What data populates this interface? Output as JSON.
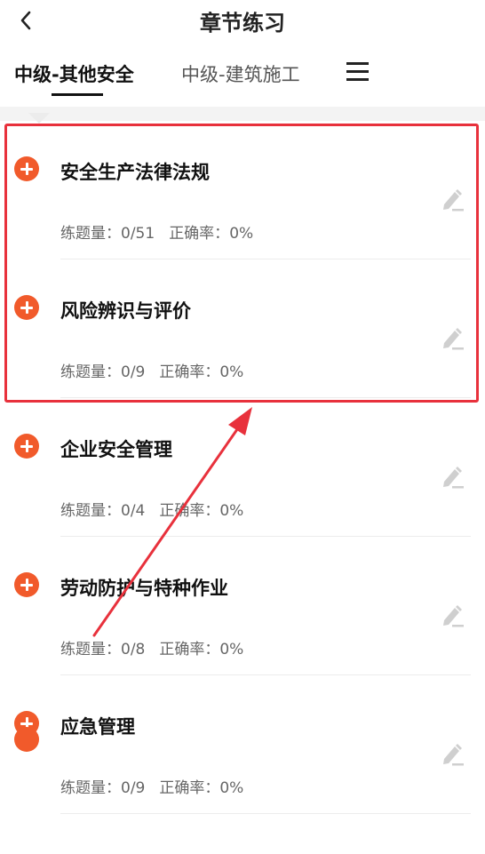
{
  "header": {
    "title": "章节练习"
  },
  "tabs": [
    {
      "label": "中级-其他安全",
      "active": true
    },
    {
      "label": "中级-建筑施工",
      "active": false
    }
  ],
  "chapters": [
    {
      "title": "安全生产法律法规",
      "count_label": "练题量：",
      "count": "0/51",
      "rate_label": "正确率：",
      "rate": "0%"
    },
    {
      "title": "风险辨识与评价",
      "count_label": "练题量：",
      "count": "0/9",
      "rate_label": "正确率：",
      "rate": "0%"
    },
    {
      "title": "企业安全管理",
      "count_label": "练题量：",
      "count": "0/4",
      "rate_label": "正确率：",
      "rate": "0%"
    },
    {
      "title": "劳动防护与特种作业",
      "count_label": "练题量：",
      "count": "0/8",
      "rate_label": "正确率：",
      "rate": "0%"
    },
    {
      "title": "应急管理",
      "count_label": "练题量：",
      "count": "0/9",
      "rate_label": "正确率：",
      "rate": "0%"
    }
  ],
  "icons": {
    "back": "chevron-left-icon",
    "menu": "hamburger-menu-icon",
    "add": "plus-circle-icon",
    "practice": "pencil-icon"
  },
  "colors": {
    "accent": "#f15a2b",
    "annotation": "#e8313c"
  }
}
